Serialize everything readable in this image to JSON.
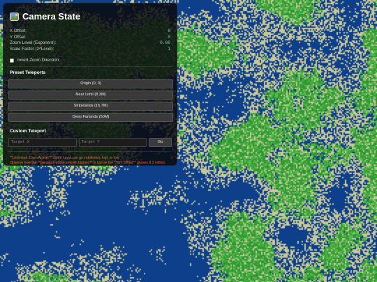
{
  "panel": {
    "title": "Camera State",
    "title_icon": "camera-map-icon",
    "stats": [
      {
        "label": "X Offset:",
        "value": "0"
      },
      {
        "label": "Y Offset:",
        "value": "0"
      },
      {
        "label": "Zoom Level (Exponent):",
        "value": "0.00"
      },
      {
        "label": "Scale Factor (2^Level):",
        "value": "1"
      }
    ],
    "invert_label": "Invert Zoom Direction",
    "invert_checked": false,
    "presets_title": "Preset Teleports",
    "presets": [
      "Origin (0, 0)",
      "Near Limit (8.3M)",
      "Stripelands (16.7M)",
      "Deep Farlands (50M)"
    ],
    "custom_title": "Custom Teleport",
    "target_x_placeholder": "Target X",
    "target_y_placeholder": "Target Y",
    "go_label": "Go",
    "note_line1": "**Unlimited Zoom Active:** Zoom Level can go indefinitely high or low.",
    "note_line2": "Observe how the **precision of the smooth biomes** is lost as the **X/Y Offset** passes 8.3 million."
  },
  "colors": {
    "grass": "#2f9a34",
    "grass_light": "#58b84a",
    "sand": "#c8c79a",
    "water": "#0d3f8a",
    "accent": "#57d7c1",
    "warning": "#e06b48"
  }
}
